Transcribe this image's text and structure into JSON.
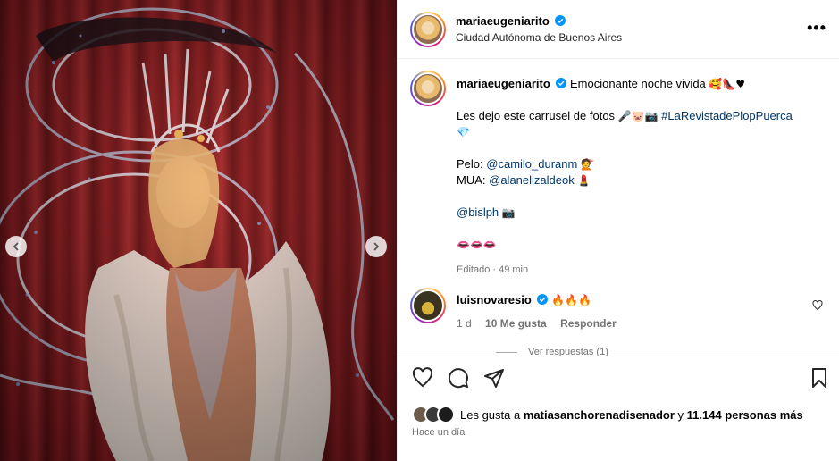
{
  "post": {
    "author": "mariaeugeniarito",
    "location": "Ciudad Autónoma de Buenos Aires",
    "more_icon": "more-horizontal-icon"
  },
  "caption": {
    "author": "mariaeugeniarito",
    "line1": "Emocionante noche vivida",
    "line1_emoji": "🥰👠♥",
    "line2": "Les dejo este carrusel de fotos",
    "line2_emoji": "🎤🐷📷",
    "hashtag": "#LaRevistadePlopPuerca",
    "line2_end_emoji": "💎",
    "pelo_label": "Pelo:",
    "pelo_handle": "@camilo_duranm",
    "pelo_emoji": "💇",
    "mua_label": "MUA:",
    "mua_handle": "@alanelizaldeok",
    "mua_emoji": "💄",
    "photo_handle": "@bislph",
    "photo_emoji": "📷",
    "lips": "👄👄👄",
    "edited": "Editado · 49 min"
  },
  "comment": {
    "author": "luisnovaresio",
    "text": "🔥🔥🔥",
    "age": "1 d",
    "likes": "10 Me gusta",
    "reply": "Responder",
    "view_replies": "Ver respuestas (1)"
  },
  "actions": {
    "liked_by_prefix": "Les gusta a",
    "liked_by_user": "matiasanchorenadisenador",
    "liked_by_mid": "y",
    "liked_by_count": "11.144 personas más",
    "time_ago": "Hace un día"
  },
  "colors": {
    "link": "#00376b",
    "verified": "#0095f6",
    "muted": "#737373"
  }
}
